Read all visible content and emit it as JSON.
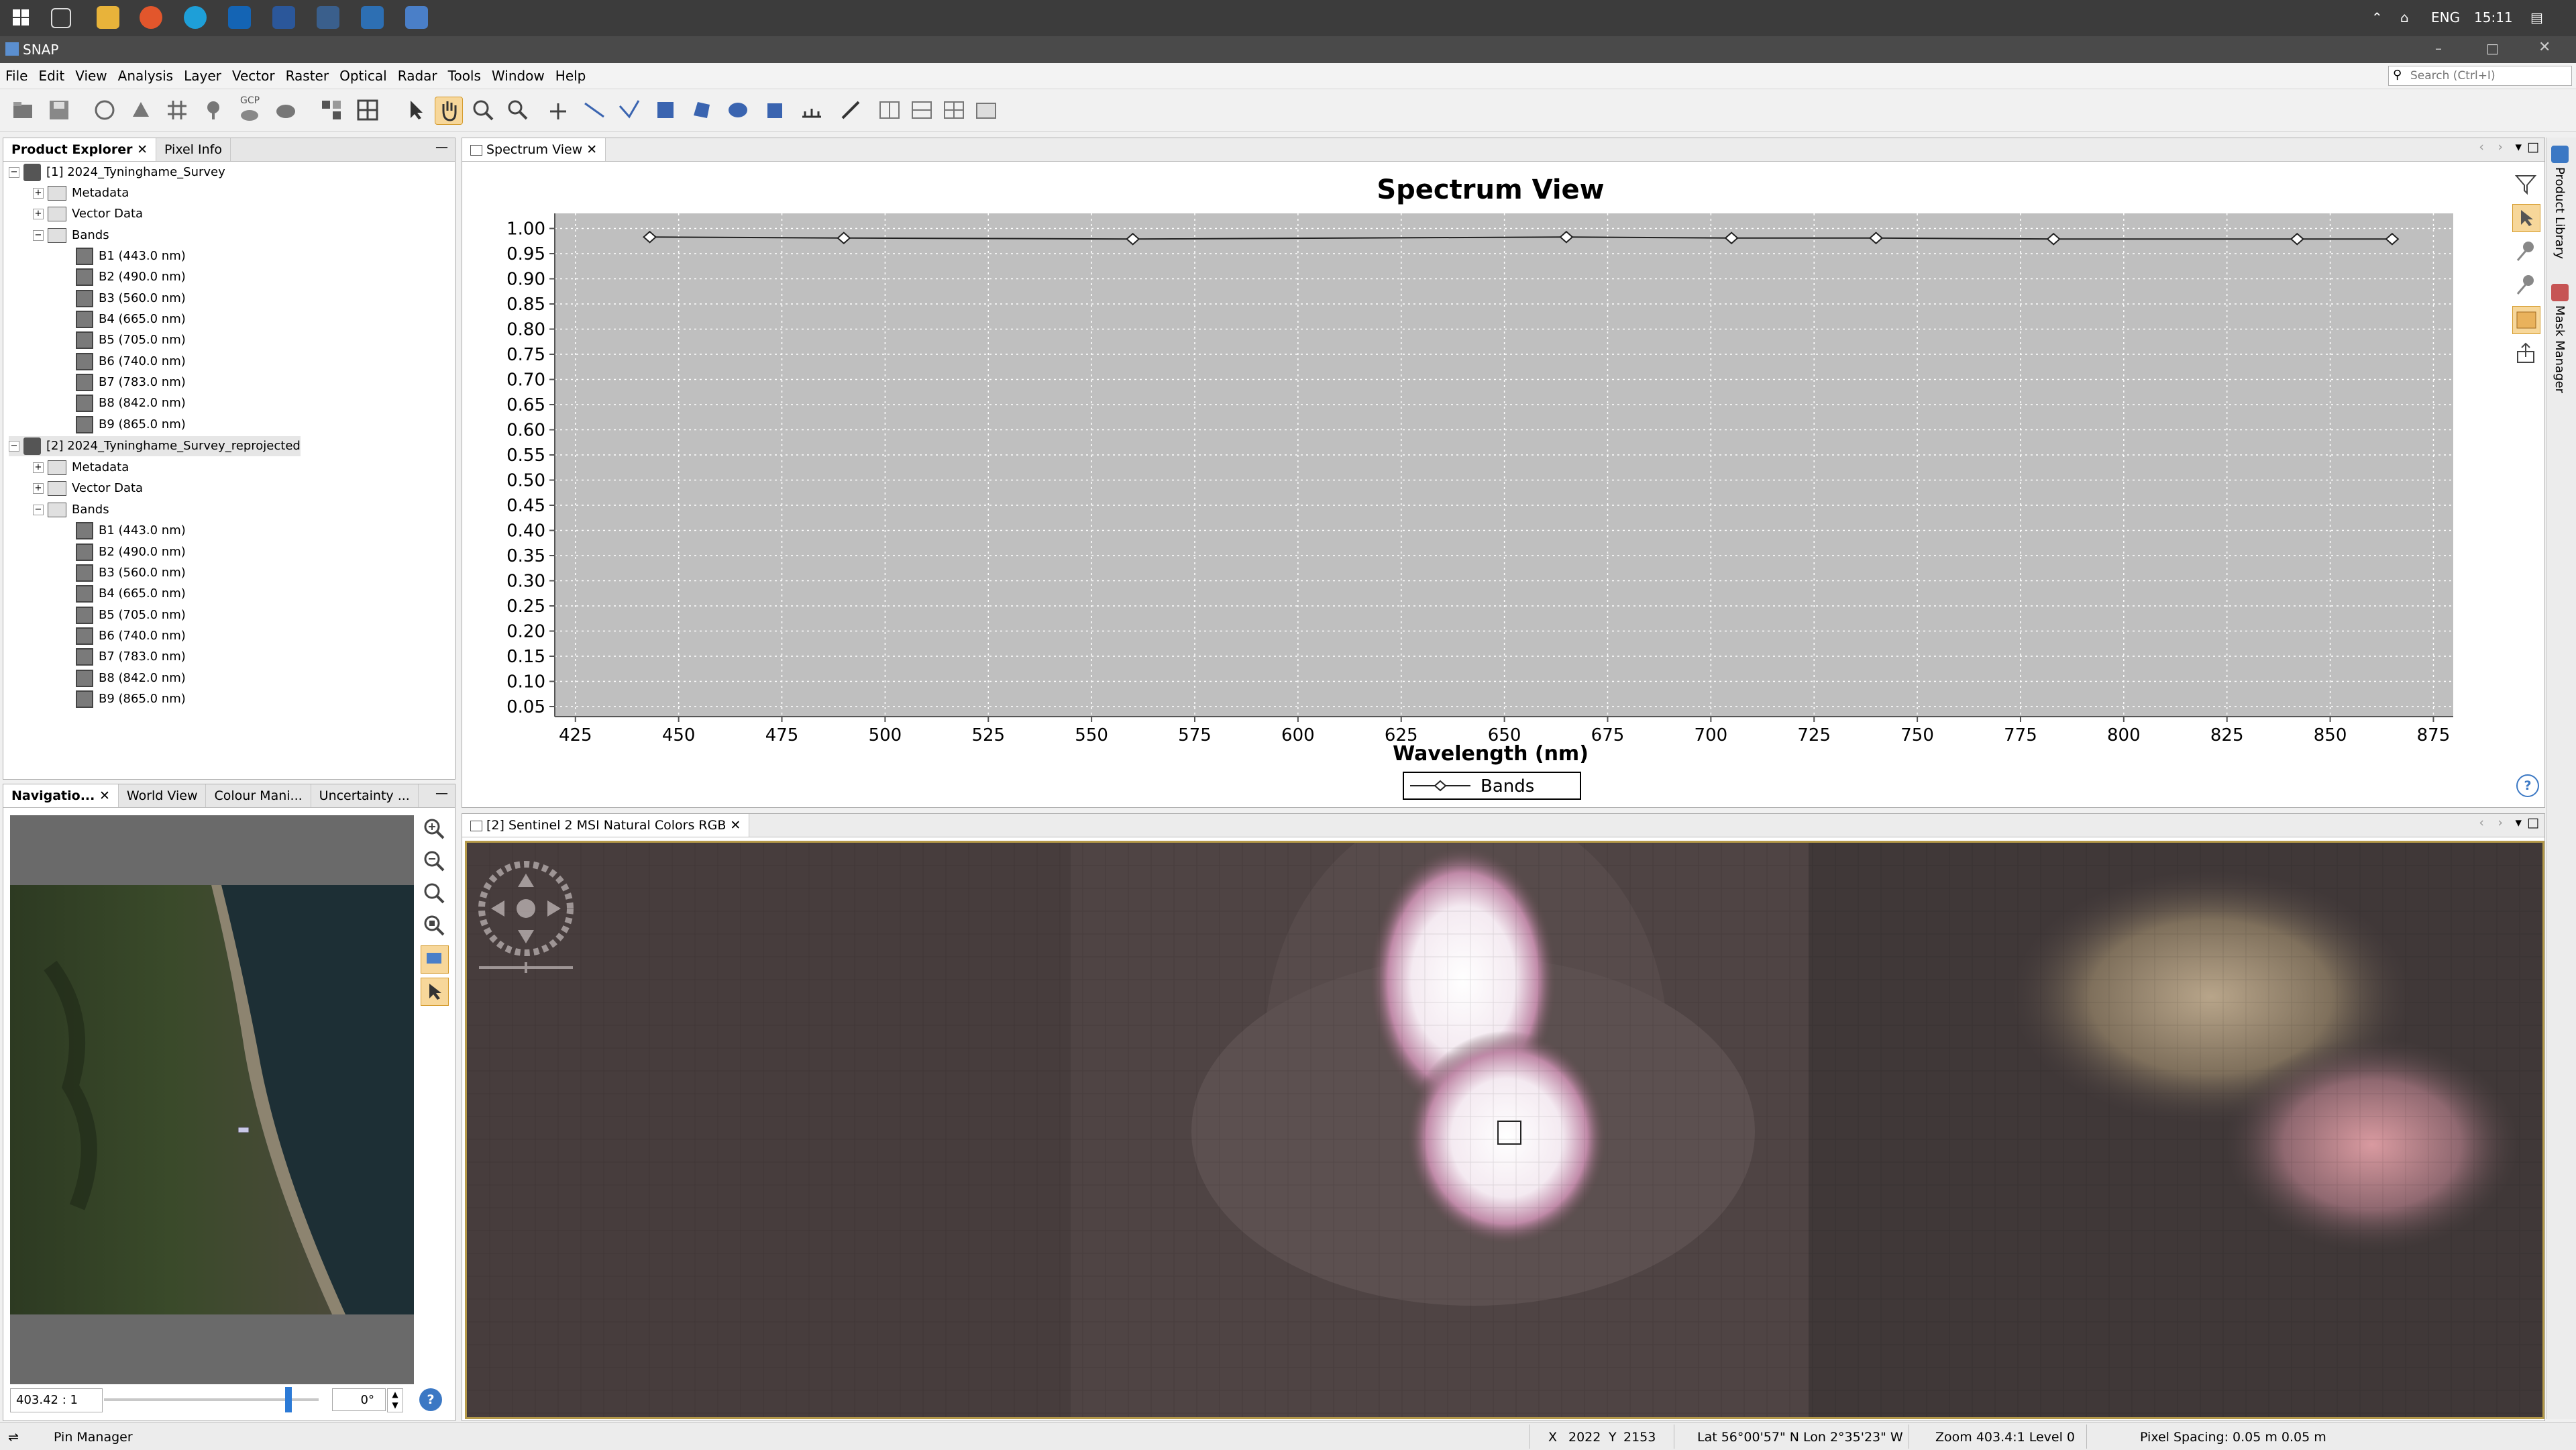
{
  "taskbar": {
    "language": "ENG",
    "time": "15:11"
  },
  "window": {
    "title": "SNAP"
  },
  "search": {
    "placeholder": "Search (Ctrl+I)"
  },
  "menu": [
    "File",
    "Edit",
    "View",
    "Analysis",
    "Layer",
    "Vector",
    "Raster",
    "Optical",
    "Radar",
    "Tools",
    "Window",
    "Help"
  ],
  "toolbar": {
    "gcp_label": "GCP"
  },
  "product_explorer": {
    "tabs": [
      "Product Explorer",
      "Pixel Info"
    ],
    "products": [
      {
        "name": "[1] 2024_Tyninghame_Survey",
        "folders": [
          "Metadata",
          "Vector Data",
          "Bands"
        ],
        "bands": [
          "B1 (443.0 nm)",
          "B2 (490.0 nm)",
          "B3 (560.0 nm)",
          "B4 (665.0 nm)",
          "B5 (705.0 nm)",
          "B6 (740.0 nm)",
          "B7 (783.0 nm)",
          "B8 (842.0 nm)",
          "B9 (865.0 nm)"
        ]
      },
      {
        "name": "[2] 2024_Tyninghame_Survey_reprojected",
        "folders": [
          "Metadata",
          "Vector Data",
          "Bands"
        ],
        "bands": [
          "B1 (443.0 nm)",
          "B2 (490.0 nm)",
          "B3 (560.0 nm)",
          "B4 (665.0 nm)",
          "B5 (705.0 nm)",
          "B6 (740.0 nm)",
          "B7 (783.0 nm)",
          "B8 (842.0 nm)",
          "B9 (865.0 nm)"
        ]
      }
    ]
  },
  "navigation": {
    "tabs": [
      "Navigatio...",
      "World View",
      "Colour Mani...",
      "Uncertainty ..."
    ],
    "zoom_value": "403.42 : 1",
    "rotation_value": "0°"
  },
  "spectrum_view": {
    "tab_label": "Spectrum View"
  },
  "image_view": {
    "tab_label": "[2] Sentinel 2 MSI Natural Colors RGB"
  },
  "right_sidebar": {
    "labels": [
      "Product Library",
      "Mask Manager"
    ]
  },
  "status_bar": {
    "pin_manager": "Pin Manager",
    "x_label": "X",
    "x_value": "2022",
    "y_label": "Y",
    "y_value": "2153",
    "lat_lon": "Lat 56°00'57\" N  Lon 2°35'23\" W",
    "zoom": "Zoom 403.4:1  Level 0",
    "pixel_spacing": "Pixel Spacing: 0.05 m 0.05 m"
  },
  "colors": {
    "chart_plot_bg": "#bfbfbf",
    "image_border": "#b59a4a"
  },
  "chart_data": {
    "type": "line",
    "title": "Spectrum View",
    "xlabel": "Wavelength (nm)",
    "ylabel": "",
    "xlim": [
      420,
      885
    ],
    "ylim": [
      0.03,
      1.03
    ],
    "x_ticks": [
      425,
      450,
      475,
      500,
      525,
      550,
      575,
      600,
      625,
      650,
      675,
      700,
      725,
      750,
      775,
      800,
      825,
      850,
      875
    ],
    "y_ticks": [
      0.05,
      0.1,
      0.15,
      0.2,
      0.25,
      0.3,
      0.35,
      0.4,
      0.45,
      0.5,
      0.55,
      0.6,
      0.65,
      0.7,
      0.75,
      0.8,
      0.85,
      0.9,
      0.95,
      1.0
    ],
    "y_tick_labels": [
      "0.05",
      "0.10",
      "0.15",
      "0.20",
      "0.25",
      "0.30",
      "0.35",
      "0.40",
      "0.45",
      "0.50",
      "0.55",
      "0.60",
      "0.65",
      "0.70",
      "0.75",
      "0.80",
      "0.85",
      "0.90",
      "0.95",
      "1.00"
    ],
    "grid": true,
    "legend_position": "bottom-center",
    "series": [
      {
        "name": "Bands",
        "x": [
          443,
          490,
          560,
          665,
          705,
          740,
          783,
          842,
          865
        ],
        "y": [
          0.983,
          0.981,
          0.979,
          0.983,
          0.981,
          0.981,
          0.979,
          0.979,
          0.979
        ]
      }
    ]
  }
}
